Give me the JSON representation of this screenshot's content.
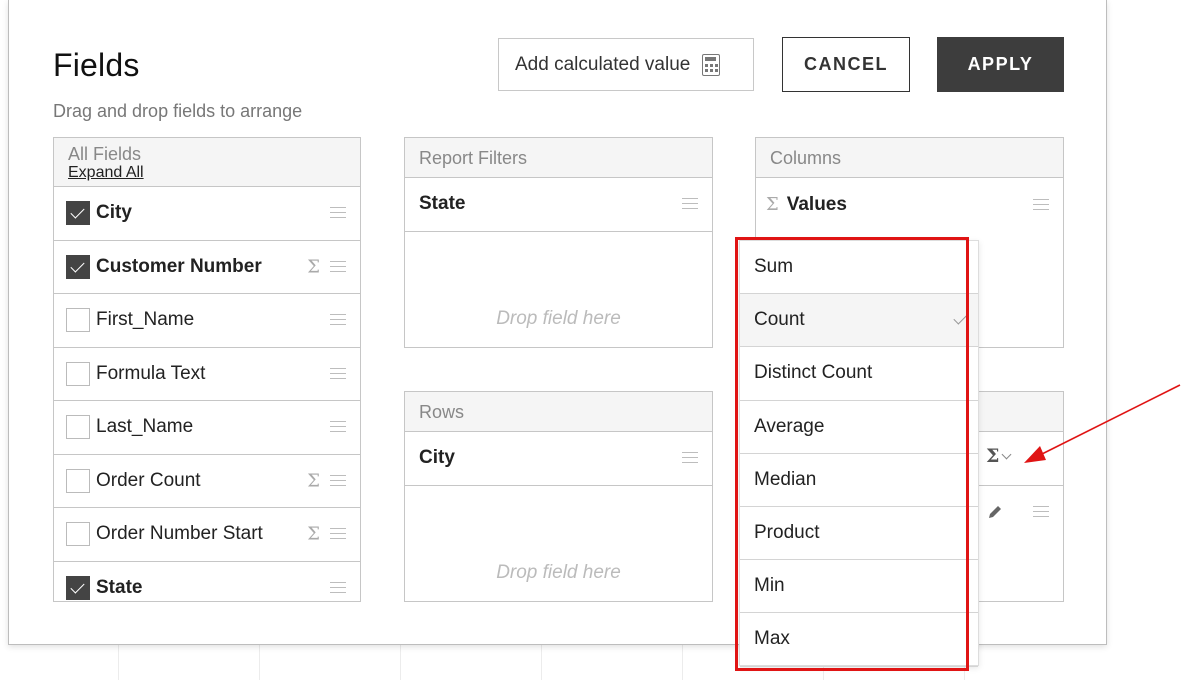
{
  "dialog": {
    "title": "Fields",
    "subtitle": "Drag and drop fields to arrange",
    "calc_button": "Add calculated value",
    "cancel_button": "CANCEL",
    "apply_button": "APPLY"
  },
  "all_fields": {
    "header": "All Fields",
    "expand_all": "Expand All",
    "items": [
      {
        "label": "City",
        "checked": true,
        "sigma": false
      },
      {
        "label": "Customer Number",
        "checked": true,
        "sigma": true
      },
      {
        "label": "First_Name",
        "checked": false,
        "sigma": false
      },
      {
        "label": "Formula Text",
        "checked": false,
        "sigma": false
      },
      {
        "label": "Last_Name",
        "checked": false,
        "sigma": false
      },
      {
        "label": "Order Count",
        "checked": false,
        "sigma": true
      },
      {
        "label": "Order Number Start",
        "checked": false,
        "sigma": true
      },
      {
        "label": "State",
        "checked": true,
        "sigma": false
      }
    ]
  },
  "report_filters": {
    "header": "Report Filters",
    "field": "State",
    "drop_text": "Drop field here"
  },
  "rows_panel": {
    "header": "Rows",
    "field": "City",
    "drop_text": "Drop field here"
  },
  "columns_panel": {
    "header": "Columns",
    "field": "Values",
    "sigma_symbol": "Σ"
  },
  "values_panel": {
    "sigma_symbol": "Σ"
  },
  "aggregation_menu": {
    "items": [
      "Sum",
      "Count",
      "Distinct Count",
      "Average",
      "Median",
      "Product",
      "Min",
      "Max"
    ],
    "selected": "Count"
  },
  "icons": {
    "sigma": "sigma-icon",
    "drag": "drag-handle-icon",
    "edit": "pencil-icon",
    "calculator": "calculator-icon",
    "check": "check-icon"
  },
  "colors": {
    "highlight": "#e01414",
    "apply_bg": "#3d3d3d"
  }
}
